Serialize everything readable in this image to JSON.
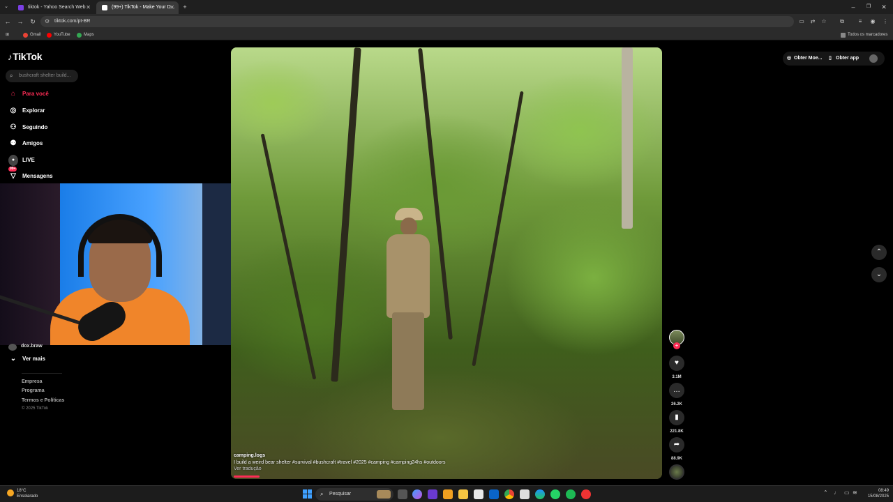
{
  "browser": {
    "tabs": [
      {
        "title": "tiktok - Yahoo Search Web",
        "favicon_color": "#7b3fe4",
        "active": false
      },
      {
        "title": "(99+) TikTok - Make Your D...",
        "favicon_color": "#ffffff",
        "active": true
      }
    ],
    "new_tab": "+",
    "url": "tiktok.com/pt-BR",
    "bookmarks": [
      {
        "label": "Gmail",
        "color": "#ea4335"
      },
      {
        "label": "YouTube",
        "color": "#ff0000"
      },
      {
        "label": "Maps",
        "color": "#34a853"
      }
    ],
    "all_bookmarks": "Todos os marcadores"
  },
  "tiktok": {
    "logo_text": "TikTok",
    "search_placeholder": "bushcraft shelter build...",
    "nav": [
      {
        "label": "Para você",
        "icon": "home-icon",
        "active": true
      },
      {
        "label": "Explorar",
        "icon": "compass-icon",
        "active": false
      },
      {
        "label": "Seguindo",
        "icon": "following-icon",
        "active": false
      },
      {
        "label": "Amigos",
        "icon": "friends-icon",
        "active": false
      },
      {
        "label": "LIVE",
        "icon": "live-icon",
        "active": false
      },
      {
        "label": "Mensagens",
        "icon": "messages-icon",
        "active": false,
        "badge": "99+"
      }
    ],
    "following_user": "dox.braw",
    "see_more": "Ver mais",
    "footer_links": [
      "Empresa",
      "Programa",
      "Termos e Políticas"
    ],
    "copyright": "© 2025 TikTok",
    "top_right": {
      "coins_label": "Obter Moe...",
      "app_label": "Obter app"
    },
    "video": {
      "author": "camping.logs",
      "caption": "I build a weird bear shelter #survival #bushcraft #travel #2025 #camping #camping24hs #outdoors",
      "translate": "Ver tradução",
      "progress": 0.06
    },
    "actions": {
      "likes": "3.1M",
      "comments": "26.2K",
      "saves": "221.8K",
      "shares": "88.9K"
    }
  },
  "taskbar": {
    "weather_temp": "18°C",
    "weather_desc": "Ensolarado",
    "search_label": "Pesquisar",
    "time": "08:49",
    "date": "15/08/2025"
  }
}
